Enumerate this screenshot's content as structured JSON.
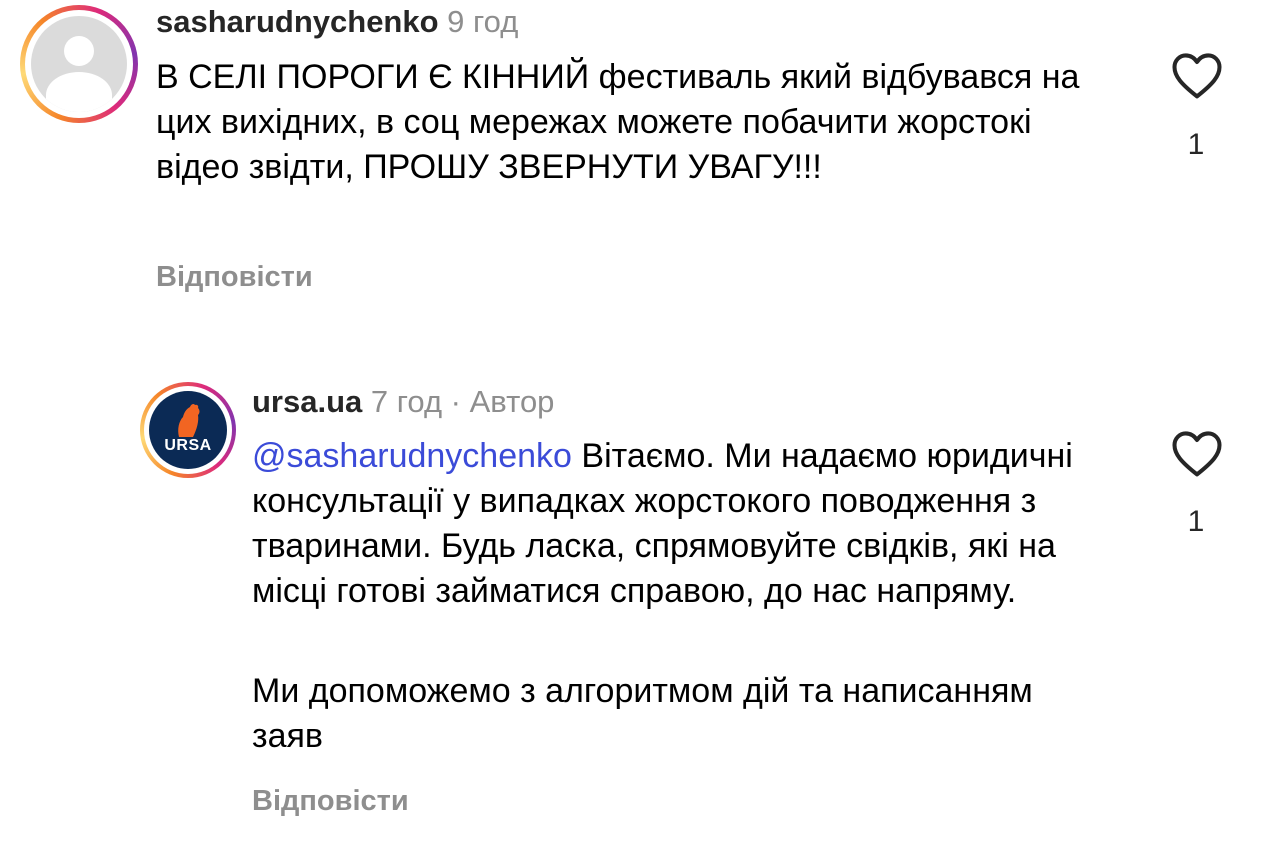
{
  "comments": [
    {
      "username": "sasharudnychenko",
      "time": "9 год",
      "text": "В СЕЛІ ПОРОГИ Є КІННИЙ фестиваль який відбувався на цих вихідних, в соц мережах можете побачити жорстокі відео звідти, ПРОШУ ЗВЕРНУТИ УВАГУ!!!",
      "reply_label": "Відповісти",
      "likes": "1",
      "avatar_icon": "default-user-avatar-icon"
    },
    {
      "username": "ursa.ua",
      "time": "7 год",
      "separator": "·",
      "author_badge": "Автор",
      "mention": "@sasharudnychenko",
      "text": "Вітаємо. Ми надаємо юридичні консультації у випадках жорстокого поводження з тваринами. Будь ласка, спрямовуйте свідків, які на місці готові займатися справою, до нас напряму.",
      "text2": "Ми допоможемо з алгоритмом дій та написанням заяв",
      "reply_label": "Відповісти",
      "likes": "1",
      "avatar_label": "URSA",
      "avatar_icon": "ursa-bear-logo-icon"
    }
  ],
  "colors": {
    "mention": "#3b4bd8",
    "meta": "#8e8e8e",
    "ursa_navy": "#0b2a55",
    "ursa_orange": "#f26522"
  }
}
